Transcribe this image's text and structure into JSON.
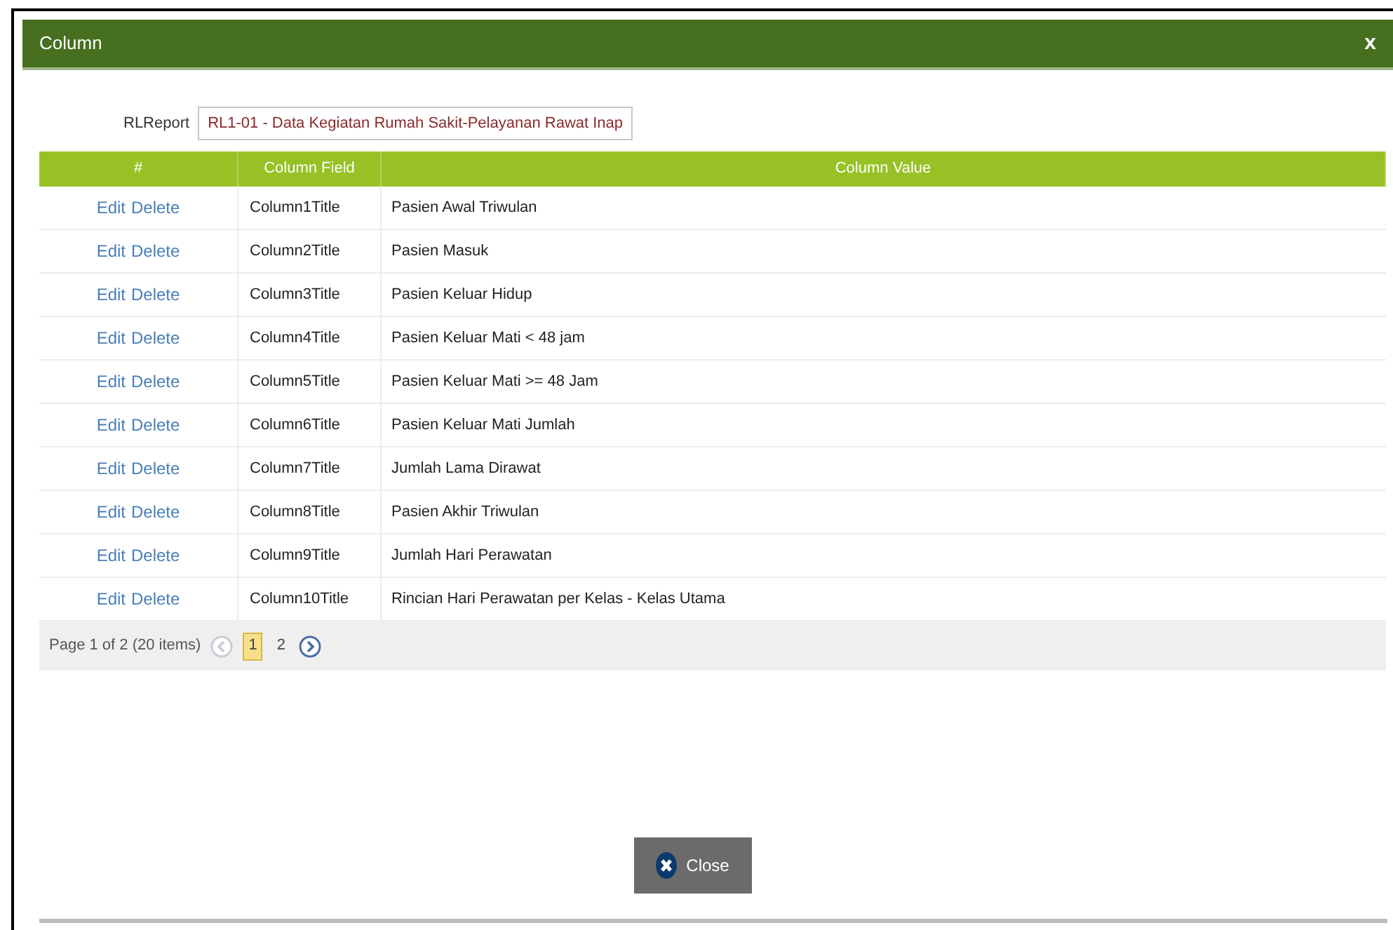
{
  "window": {
    "title": "Column",
    "close_glyph": "x"
  },
  "report": {
    "label": "RLReport",
    "value": "RL1-01 - Data Kegiatan Rumah Sakit-Pelayanan Rawat Inap"
  },
  "table": {
    "columns": [
      "#",
      "Column Field",
      "Column Value"
    ],
    "rows": [
      {
        "edit": "Edit",
        "delete": "Delete",
        "field": "Column1Title",
        "value": "Pasien Awal Triwulan"
      },
      {
        "edit": "Edit",
        "delete": "Delete",
        "field": "Column2Title",
        "value": "Pasien Masuk"
      },
      {
        "edit": "Edit",
        "delete": "Delete",
        "field": "Column3Title",
        "value": "Pasien Keluar Hidup"
      },
      {
        "edit": "Edit",
        "delete": "Delete",
        "field": "Column4Title",
        "value": "Pasien Keluar Mati < 48 jam"
      },
      {
        "edit": "Edit",
        "delete": "Delete",
        "field": "Column5Title",
        "value": "Pasien Keluar Mati >= 48 Jam"
      },
      {
        "edit": "Edit",
        "delete": "Delete",
        "field": "Column6Title",
        "value": "Pasien Keluar Mati Jumlah"
      },
      {
        "edit": "Edit",
        "delete": "Delete",
        "field": "Column7Title",
        "value": "Jumlah Lama Dirawat"
      },
      {
        "edit": "Edit",
        "delete": "Delete",
        "field": "Column8Title",
        "value": "Pasien Akhir Triwulan"
      },
      {
        "edit": "Edit",
        "delete": "Delete",
        "field": "Column9Title",
        "value": "Jumlah Hari Perawatan"
      },
      {
        "edit": "Edit",
        "delete": "Delete",
        "field": "Column10Title",
        "value": "Rincian Hari Perawatan per Kelas - Kelas Utama"
      }
    ]
  },
  "pager": {
    "summary": "Page 1 of 2 (20 items)",
    "prev_disabled": true,
    "next_disabled": false,
    "pages": [
      {
        "label": "1",
        "selected": true
      },
      {
        "label": "2",
        "selected": false
      }
    ]
  },
  "close_button": {
    "label": "Close"
  }
}
